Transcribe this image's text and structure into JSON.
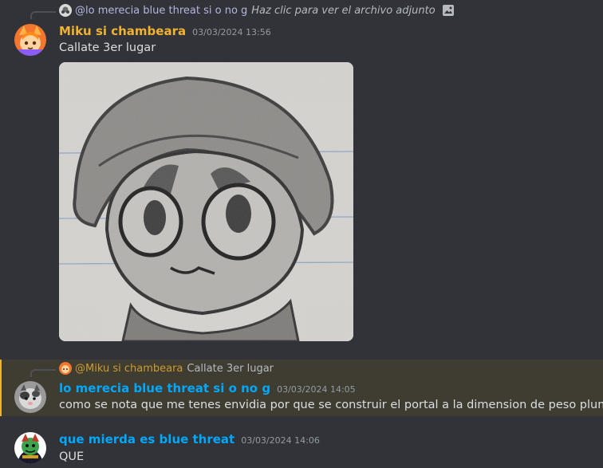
{
  "messages": [
    {
      "reply": {
        "name": "@lo merecia blue threat si o no g",
        "text": "Haz clic para ver el archivo adjunto"
      },
      "author": "Miku si chambeara",
      "author_color": "#f0b232",
      "timestamp": "03/03/2024 13:56",
      "content": "Callate 3er lugar"
    },
    {
      "reply": {
        "name": "@Miku si chambeara",
        "text": "Callate 3er lugar"
      },
      "author": "lo merecia blue threat si o no g",
      "author_color": "#00a8fc",
      "timestamp": "03/03/2024 14:05",
      "content": "como se nota que me tenes envidia por que se construir el portal a la dimension de peso pluma"
    },
    {
      "author": "que mierda es blue threat",
      "author_color": "#00a8fc",
      "timestamp": "03/03/2024 14:06",
      "content": "QUE"
    }
  ],
  "colors": {
    "background": "#313338",
    "mention_highlight": "#3f3c32",
    "mention_bar": "#f0b232"
  }
}
